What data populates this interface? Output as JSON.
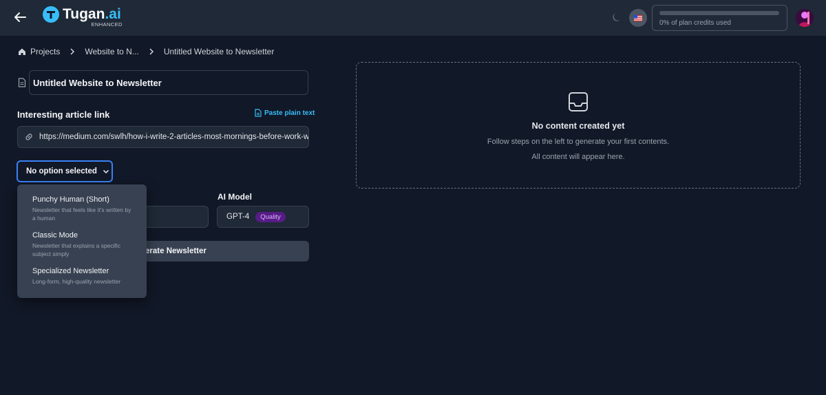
{
  "header": {
    "brand_name": "Tugan",
    "brand_suffix": ".ai",
    "brand_tagline": "ENHANCED",
    "credits_label": "0% of plan credits used",
    "credits_used_percent": 0,
    "accent_color": "#38bdf8"
  },
  "breadcrumb": {
    "items": [
      "Projects",
      "Website to N...",
      "Untitled Website to Newsletter"
    ]
  },
  "form": {
    "title_value": "Untitled Website to Newsletter",
    "article_label": "Interesting article link",
    "paste_label": "Paste plain text",
    "url_value": "https://medium.com/swlh/how-i-write-2-articles-most-mornings-before-work-w",
    "mode_select_value": "No option selected",
    "ai_model_label": "AI Model",
    "ai_model_value": "GPT-4",
    "ai_model_badge": "Quality",
    "generate_label": "Generate Newsletter",
    "generate_visible_label": "nerate Newsletter"
  },
  "mode_dropdown": {
    "options": [
      {
        "title": "Punchy Human (Short)",
        "desc": "Newsletter that feels like it's written by a human"
      },
      {
        "title": "Classic Mode",
        "desc": "Newsletter that explains a specific subject simply"
      },
      {
        "title": "Specialized Newsletter",
        "desc": "Long-form, high-quality newsletter"
      }
    ]
  },
  "empty_state": {
    "title": "No content created yet",
    "line1": "Follow steps on the left to generate your first contents.",
    "line2": "All content will appear here."
  },
  "icons": {
    "back": "arrow-left-icon",
    "theme": "moon-icon",
    "language": "us-flag-icon",
    "home": "home-icon",
    "document": "document-icon",
    "link": "link-icon",
    "inbox": "inbox-icon"
  }
}
